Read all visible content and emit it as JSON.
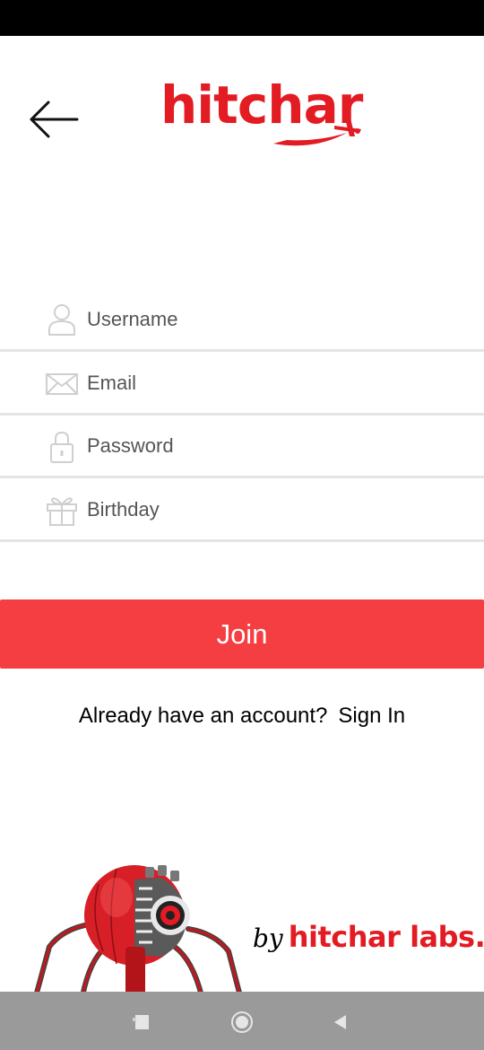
{
  "brand": {
    "logo_text": "hitchar",
    "accent_color": "#e31b23"
  },
  "form": {
    "fields": [
      {
        "name": "username",
        "icon": "user-icon",
        "placeholder": "Username"
      },
      {
        "name": "email",
        "icon": "envelope-icon",
        "placeholder": "Email"
      },
      {
        "name": "password",
        "icon": "lock-icon",
        "placeholder": "Password"
      },
      {
        "name": "birthday",
        "icon": "gift-icon",
        "placeholder": "Birthday"
      }
    ]
  },
  "join_button": {
    "label": "Join",
    "color": "#f43e41"
  },
  "signin": {
    "prompt": "Already have an account?",
    "link": "Sign In"
  },
  "footer": {
    "by_text": "by",
    "labs_text": "hitchar labs."
  },
  "navbar": {
    "buttons": [
      "recent-apps",
      "home",
      "back"
    ]
  }
}
